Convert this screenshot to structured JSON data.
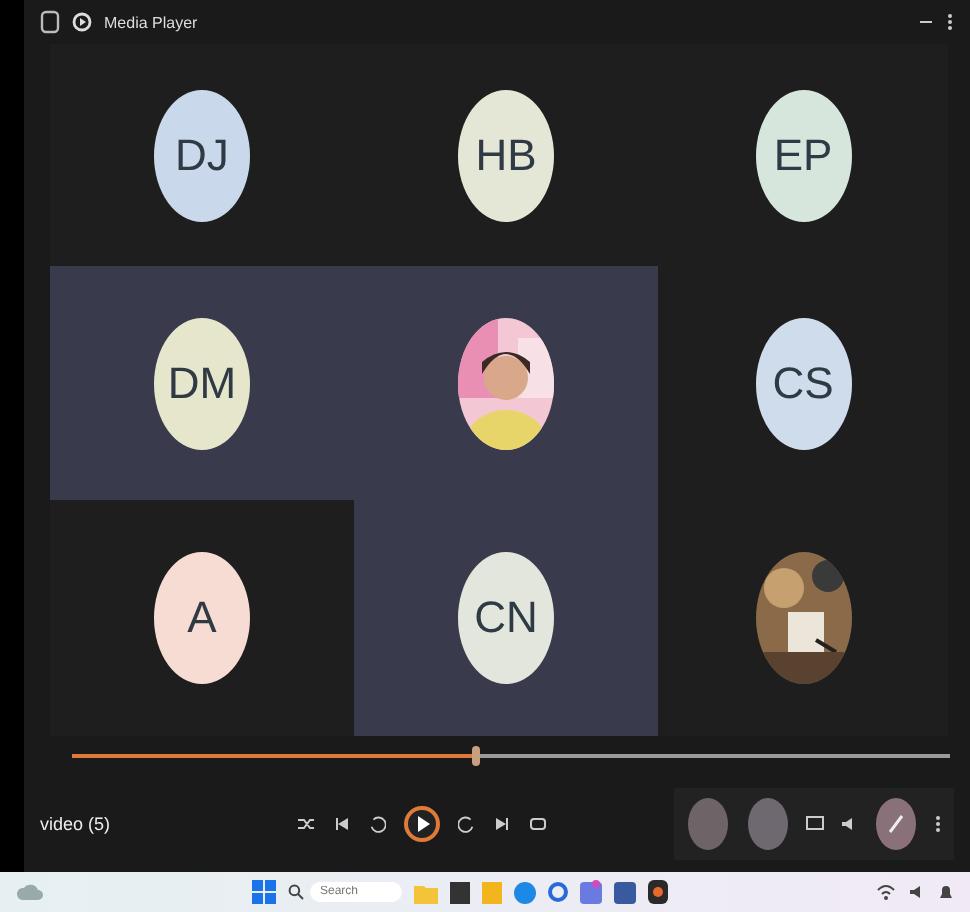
{
  "window": {
    "title": "Media Player"
  },
  "tiles": [
    {
      "kind": "initials",
      "initials": "DJ",
      "color": "#c9d8ea",
      "highlighted": false
    },
    {
      "kind": "initials",
      "initials": "HB",
      "color": "#e4e6d6",
      "highlighted": false
    },
    {
      "kind": "initials",
      "initials": "EP",
      "color": "#d6e6dc",
      "highlighted": false
    },
    {
      "kind": "initials",
      "initials": "DM",
      "color": "#e6e6cc",
      "highlighted": true
    },
    {
      "kind": "picture",
      "highlighted": true
    },
    {
      "kind": "initials",
      "initials": "CS",
      "color": "#cfdcec",
      "highlighted": false
    },
    {
      "kind": "initials",
      "initials": "A",
      "color": "#f6dcd2",
      "highlighted": false
    },
    {
      "kind": "initials",
      "initials": "CN",
      "color": "#e2e6dc",
      "highlighted": true
    },
    {
      "kind": "picture",
      "highlighted": false
    }
  ],
  "seek": {
    "level": 0.46
  },
  "player": {
    "title": "video (5)",
    "playing": false
  },
  "taskbar": {
    "search_placeholder": "Search"
  }
}
